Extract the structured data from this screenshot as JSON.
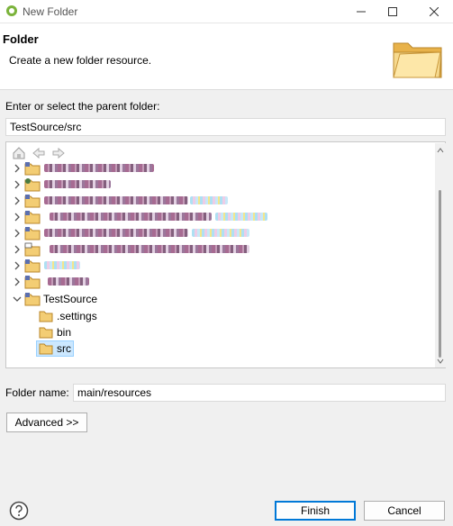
{
  "window": {
    "title": "New Folder"
  },
  "header": {
    "title": "Folder",
    "description": "Create a new folder resource."
  },
  "parent": {
    "label": "Enter or select the parent folder:",
    "value": "TestSource/src"
  },
  "tree": {
    "toolbar": [
      "home-icon",
      "back-icon",
      "forward-icon"
    ],
    "expanded_project": "TestSource",
    "children": [
      ".settings",
      "bin",
      "src"
    ],
    "selected": "src"
  },
  "folder_name": {
    "label": "Folder name:",
    "value": "main/resources"
  },
  "buttons": {
    "advanced": "Advanced >>",
    "finish": "Finish",
    "cancel": "Cancel"
  },
  "colors": {
    "selection": "#cce8ff",
    "primary_border": "#0078d7"
  }
}
